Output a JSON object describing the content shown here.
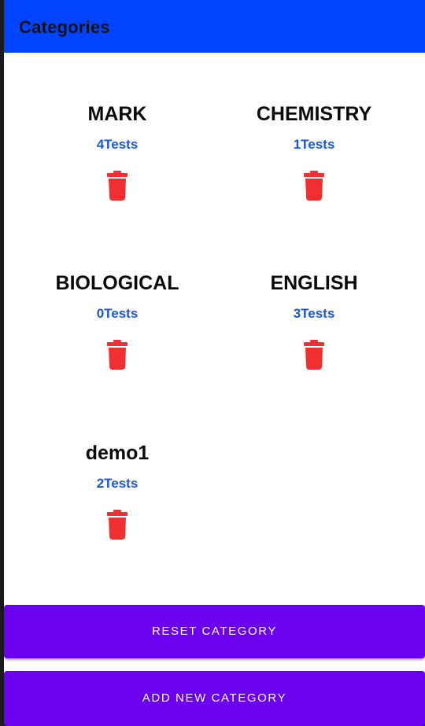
{
  "appbar": {
    "title": "Categories"
  },
  "colors": {
    "appbar": "#0044ff",
    "count_text": "#1a56e0",
    "delete_icon": "#f03030",
    "button": "#6a00ee"
  },
  "categories": [
    {
      "name": "MARK",
      "count": "4Tests",
      "icon": "trash-icon"
    },
    {
      "name": "CHEMISTRY",
      "count": "1Tests",
      "icon": "trash-icon"
    },
    {
      "name": "BIOLOGICAL",
      "count": "0Tests",
      "icon": "trash-icon"
    },
    {
      "name": "ENGLISH",
      "count": "3Tests",
      "icon": "trash-icon"
    },
    {
      "name": "demo1",
      "count": "2Tests",
      "icon": "trash-icon"
    }
  ],
  "actions": {
    "reset_label": "RESET CATEGORY",
    "add_label": "ADD NEW CATEGORY"
  }
}
